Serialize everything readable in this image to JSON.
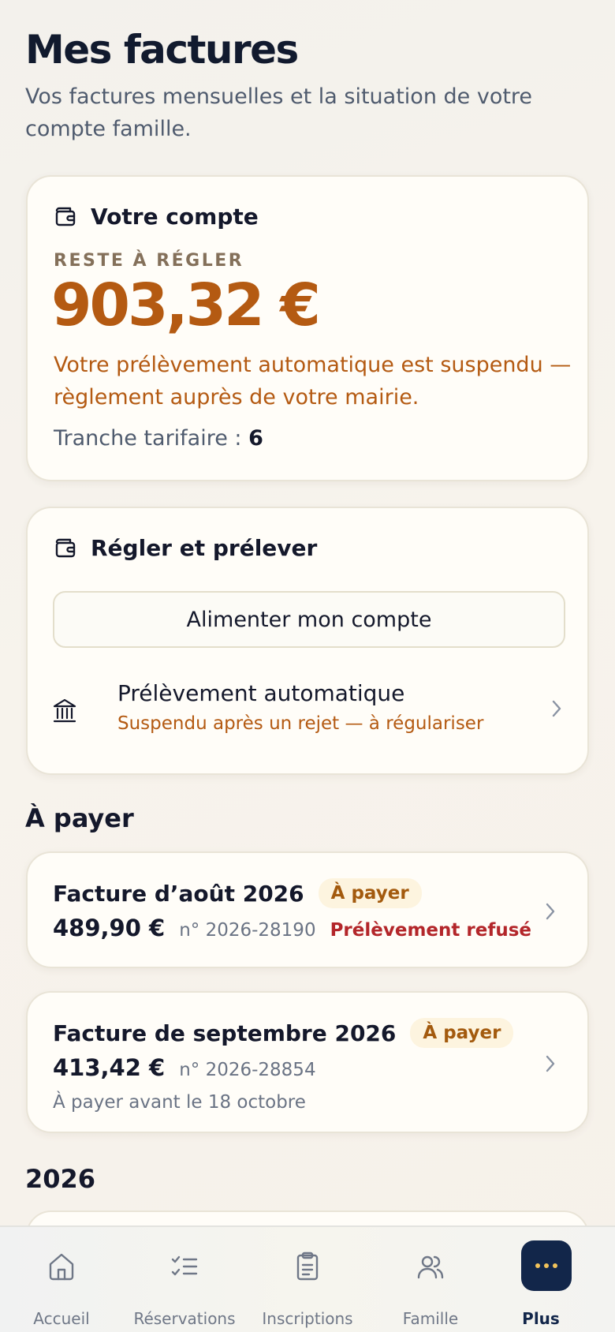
{
  "header": {
    "title": "Mes factures",
    "subtitle": "Vos factures mensuelles et la situation de votre compte famille."
  },
  "account_card": {
    "title": "Votre compte",
    "rest_label": "RESTE À RÉGLER",
    "amount": "903,32 €",
    "suspend_message": "Votre prélèvement automatique est suspendu — règlement auprès de votre mairie.",
    "tranche_label": "Tranche tarifaire :",
    "tranche_value": "6"
  },
  "pay_card": {
    "title": "Régler et prélever",
    "fund_button": "Alimenter mon compte",
    "debit_title": "Prélèvement automatique",
    "debit_status": "Suspendu après un rejet — à régulariser"
  },
  "to_pay_section": {
    "title": "À payer",
    "invoices": [
      {
        "title": "Facture d’août 2026",
        "badge": "À payer",
        "amount": "489,90 €",
        "number": "n° 2026-28190",
        "status": "Prélèvement refusé"
      },
      {
        "title": "Facture de septembre 2026",
        "badge": "À payer",
        "amount": "413,42 €",
        "number": "n° 2026-28854",
        "due": "À payer avant le 18 octobre"
      }
    ]
  },
  "year_section": {
    "title": "2026"
  },
  "bottom_nav": {
    "items": [
      {
        "label": "Accueil",
        "icon": "home-icon"
      },
      {
        "label": "Réservations",
        "icon": "checklist-icon"
      },
      {
        "label": "Inscriptions",
        "icon": "clipboard-icon"
      },
      {
        "label": "Famille",
        "icon": "users-icon"
      },
      {
        "label": "Plus",
        "icon": "more-dots-icon",
        "active": true
      }
    ]
  },
  "colors": {
    "accent_orange": "#b45a12",
    "error_red": "#b3262a",
    "nav_active": "#12264a",
    "badge_bg": "#fdf4df"
  }
}
